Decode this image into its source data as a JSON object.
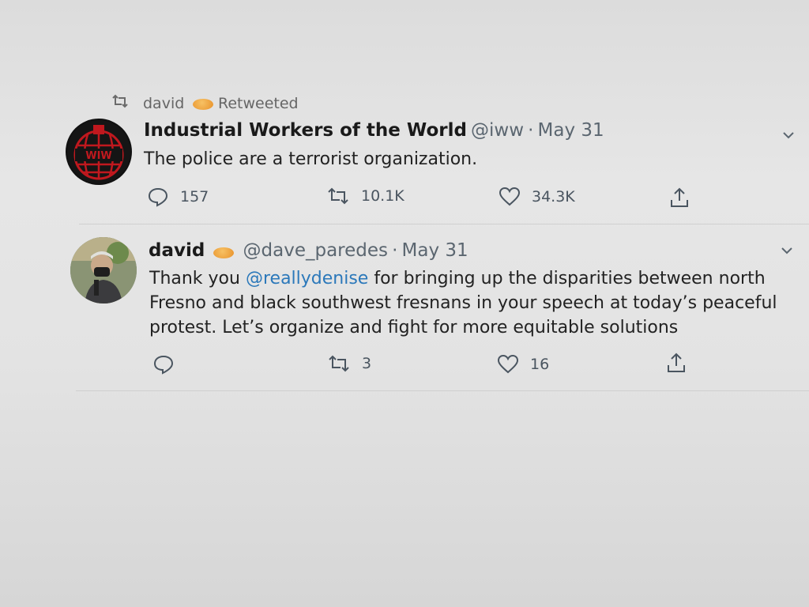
{
  "retweet_context": {
    "user": "david",
    "action": "Retweeted"
  },
  "tweets": [
    {
      "name": "Industrial Workers of the World",
      "handle": "@iww",
      "date": "May 31",
      "text": "The police are a terrorist organization.",
      "reply_count": "157",
      "retweet_count": "10.1K",
      "like_count": "34.3K"
    },
    {
      "name": "david",
      "handle": "@dave_paredes",
      "date": "May 31",
      "text_before": "Thank you ",
      "mention": "@reallydenise",
      "text_line1": " for bringing up the disparities between north",
      "text_line2": "Fresno and black southwest fresnans in your speech at today’s peaceful",
      "text_line3": "protest. Let’s organize and fight for more equitable solutions",
      "reply_count": "",
      "retweet_count": "3",
      "like_count": "16"
    }
  ],
  "separator": "·",
  "icons": {
    "retweet": "retweet-icon",
    "reply": "reply-icon",
    "like": "heart-icon",
    "share": "share-icon",
    "more": "chevron-down-icon",
    "badge": "emoji-badge-icon"
  },
  "colors": {
    "link": "#2b78ba",
    "muted": "#5b6670",
    "iww_red": "#c0181e"
  }
}
